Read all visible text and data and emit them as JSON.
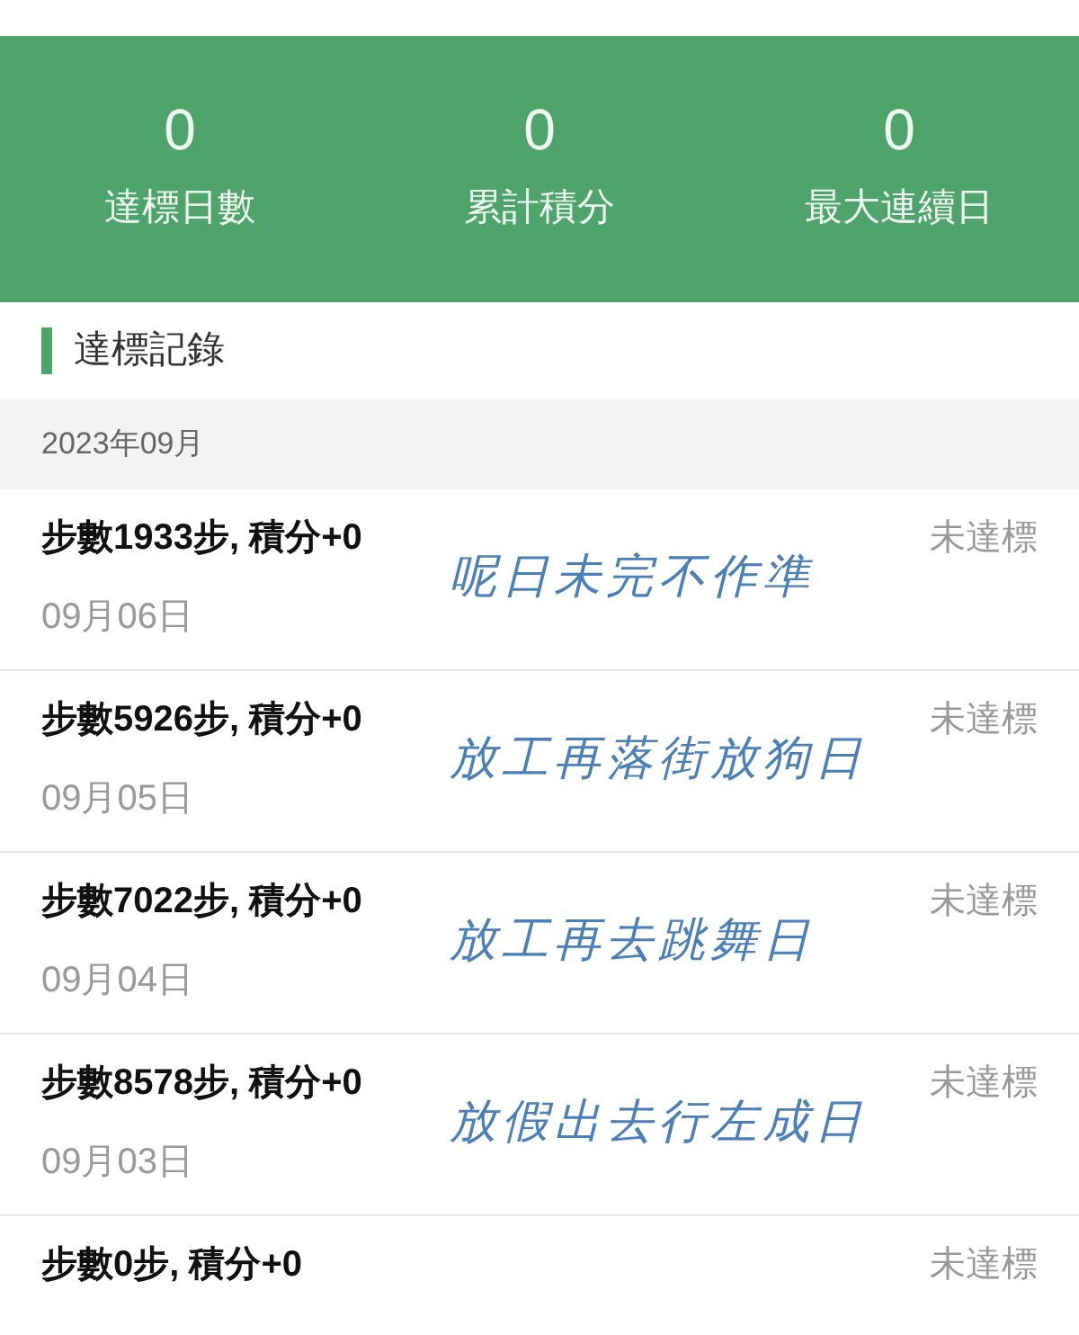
{
  "summary": [
    {
      "value": "0",
      "label": "達標日數"
    },
    {
      "value": "0",
      "label": "累計積分"
    },
    {
      "value": "0",
      "label": "最大連續日"
    }
  ],
  "section_title": "達標記錄",
  "month": "2023年09月",
  "records": [
    {
      "title": "步數1933步, 積分+0",
      "date": "09月06日",
      "status": "未達標",
      "note": "呢日未完不作準"
    },
    {
      "title": "步數5926步, 積分+0",
      "date": "09月05日",
      "status": "未達標",
      "note": "放工再落街放狗日"
    },
    {
      "title": "步數7022步, 積分+0",
      "date": "09月04日",
      "status": "未達標",
      "note": "放工再去跳舞日"
    },
    {
      "title": "步數8578步, 積分+0",
      "date": "09月03日",
      "status": "未達標",
      "note": "放假出去行左成日"
    },
    {
      "title": "步數0步, 積分+0",
      "status": "未達標"
    }
  ]
}
